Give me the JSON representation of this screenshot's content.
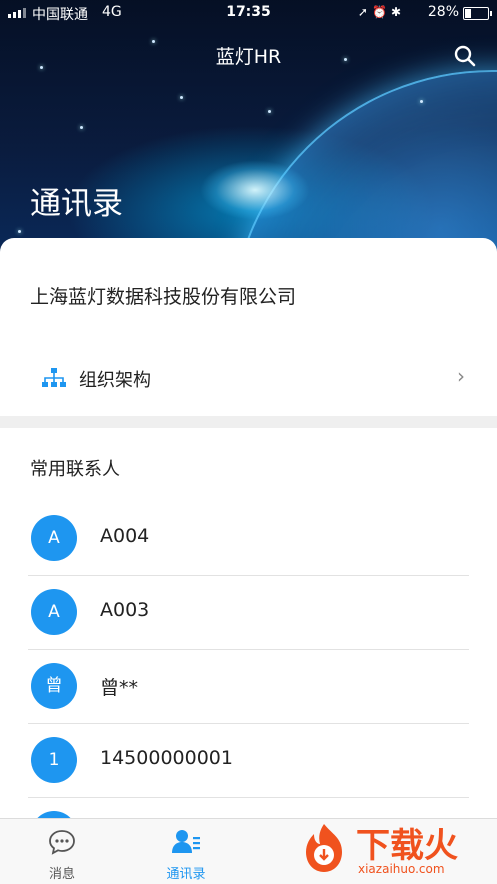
{
  "status_bar": {
    "carrier": "中国联通",
    "network": "4G",
    "time": "17:35",
    "battery": "28%",
    "battery_level": 0.28
  },
  "header": {
    "app_title": "蓝灯HR",
    "page_heading": "通讯录",
    "search_icon": "search-icon"
  },
  "company": {
    "name": "上海蓝灯数据科技股份有限公司"
  },
  "org": {
    "label": "组织架构",
    "icon": "org-chart-icon",
    "icon_color": "#1e96f0"
  },
  "contacts_section": {
    "title": "常用联系人",
    "items": [
      {
        "avatar": "A",
        "name": "A004"
      },
      {
        "avatar": "A",
        "name": "A003"
      },
      {
        "avatar": "曾",
        "name": "曾**"
      },
      {
        "avatar": "1",
        "name": "14500000001"
      },
      {
        "avatar": "",
        "name": ""
      }
    ]
  },
  "tabbar": {
    "tabs": [
      {
        "label": "消息",
        "icon": "message-icon",
        "active": false
      },
      {
        "label": "通讯录",
        "icon": "contacts-icon",
        "active": true
      }
    ],
    "active_color": "#1e96f0",
    "inactive_color": "#555555"
  },
  "watermark": {
    "text": "下载火",
    "sub": "xiazaihuo.com",
    "color": "#f0521e"
  },
  "colors": {
    "accent": "#1e96f0"
  }
}
